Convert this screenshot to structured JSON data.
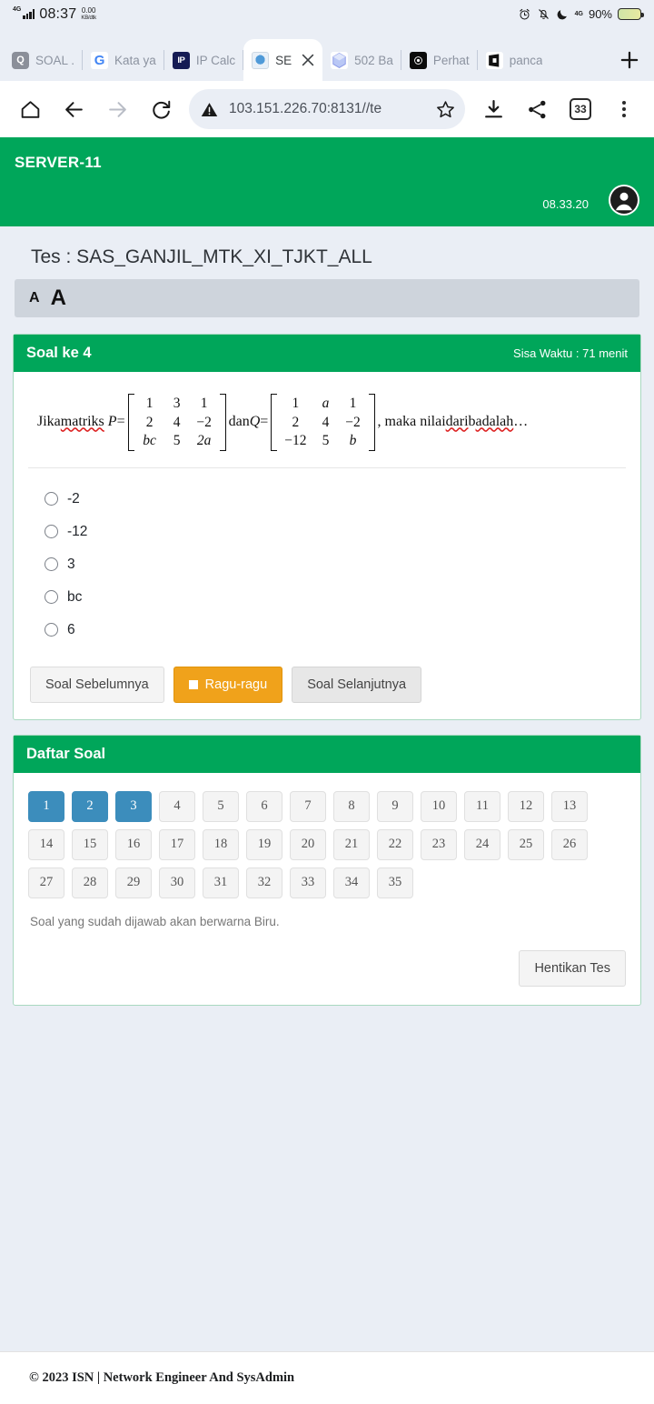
{
  "statusbar": {
    "network": "4G",
    "time": "08:37",
    "speed_value": "0.00",
    "speed_unit": "KB/dtk",
    "battery_percent": "90%",
    "icons": [
      "alarm-icon",
      "bell-muted-icon",
      "moon-icon",
      "4g-icon",
      "battery-icon"
    ]
  },
  "browser": {
    "tabs": [
      {
        "label": "SOAL .",
        "favicon": "soal-favicon",
        "active": false
      },
      {
        "label": "Kata ya",
        "favicon": "google-favicon",
        "active": false
      },
      {
        "label": "IP Calc",
        "favicon": "ipcalc-favicon",
        "active": false
      },
      {
        "label": "SE",
        "favicon": "server-favicon",
        "active": true
      },
      {
        "label": "502 Ba",
        "favicon": "hex-favicon",
        "active": false
      },
      {
        "label": "Perhat",
        "favicon": "perhat-favicon",
        "active": false
      },
      {
        "label": "panca",
        "favicon": "panca-favicon",
        "active": false
      }
    ],
    "new_tab_label": "+",
    "url": "103.151.226.70:8131//te",
    "tab_count": "33",
    "toolbar_icons": [
      "home-icon",
      "back-icon",
      "forward-icon",
      "reload-icon",
      "warning-icon",
      "star-icon",
      "download-icon",
      "share-icon",
      "tab-count-icon",
      "menu-kebab-icon"
    ]
  },
  "app": {
    "brand": "SERVER-11",
    "clock": "08.33.20",
    "avatar": "user-avatar-icon"
  },
  "test": {
    "title": "Tes : SAS_GANJIL_MTK_XI_TJKT_ALL",
    "font_small_label": "A",
    "font_large_label": "A"
  },
  "question_card": {
    "header": "Soal ke 4",
    "time_left": "Sisa Waktu : 71 menit",
    "question": {
      "lead": "Jika ",
      "word_matriks": "matriks",
      "p_symbol": "P",
      "equals": " = ",
      "matrix_p": [
        [
          "1",
          "3",
          "1"
        ],
        [
          "2",
          "4",
          "−2"
        ],
        [
          "bc",
          "5",
          "2a"
        ]
      ],
      "conj": " dan ",
      "q_symbol": "Q",
      "matrix_q": [
        [
          "1",
          "a",
          "1"
        ],
        [
          "2",
          "4",
          "−2"
        ],
        [
          "−12",
          "5",
          "b"
        ]
      ],
      "tail_1": ", maka nilai ",
      "tail_dari": "dari",
      "tail_2": " b ",
      "tail_adalah": "adalah",
      "tail_3": "…"
    },
    "options": [
      {
        "label": "-2",
        "selected": false
      },
      {
        "label": "-12",
        "selected": false
      },
      {
        "label": "3",
        "selected": false
      },
      {
        "label": "bc",
        "selected": false
      },
      {
        "label": "6",
        "selected": false
      }
    ],
    "nav": {
      "prev": "Soal Sebelumnya",
      "doubt": "Ragu-ragu",
      "next": "Soal Selanjutnya"
    }
  },
  "question_list": {
    "header": "Daftar Soal",
    "numbers": [
      "1",
      "2",
      "3",
      "4",
      "5",
      "6",
      "7",
      "8",
      "9",
      "10",
      "11",
      "12",
      "13",
      "14",
      "15",
      "16",
      "17",
      "18",
      "19",
      "20",
      "21",
      "22",
      "23",
      "24",
      "25",
      "26",
      "27",
      "28",
      "29",
      "30",
      "31",
      "32",
      "33",
      "34",
      "35"
    ],
    "answered": [
      "1",
      "2",
      "3"
    ],
    "note": "Soal yang sudah dijawab akan berwarna Biru.",
    "stop_label": "Hentikan Tes"
  },
  "footer": {
    "text": "© 2023 ISN | Network Engineer And SysAdmin"
  },
  "colors": {
    "green": "#00a65a",
    "blue": "#3c8dbc",
    "orange": "#f0a21b",
    "page_bg": "#eaeef5"
  }
}
